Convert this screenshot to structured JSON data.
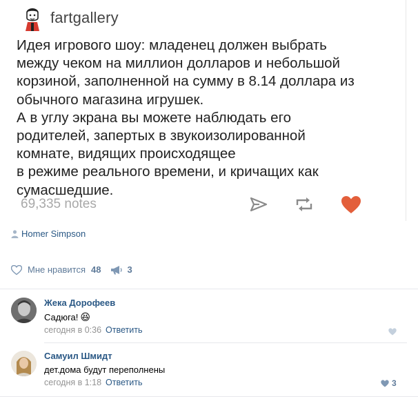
{
  "tumblr": {
    "username": "fartgallery",
    "text_lines": [
      "Идея игрового шоу: младенец должен выбрать",
      "между чеком на миллион долларов и небольшой",
      "корзиной, заполненной на сумму в 8.14 доллара из",
      "обычного магазина игрушек.",
      "А в углу экрана вы можете наблюдать его",
      "родителей, запертых в звукоизолированной",
      "комнате, видящих происходящее",
      "в режиме реального времени, и кричащих как",
      "сумасшедшие."
    ],
    "notes": "69,335 notes",
    "icons": [
      "share-icon",
      "reblog-icon",
      "heart-icon"
    ],
    "heart_color": "#e35f3b"
  },
  "post": {
    "author": "Homer Simpson",
    "author_icon": "person-icon",
    "like_label": "Мне нравится",
    "like_count": "48",
    "share_count": "3",
    "accent": "#2a5885",
    "muted": "#5e7a99"
  },
  "comments": [
    {
      "name": "Жека Дорофеев",
      "text": "Садюга!",
      "emoji": "😆",
      "time": "сегодня в 0:36",
      "reply": "Ответить",
      "likes": ""
    },
    {
      "name": "Самуил Шмидт",
      "text": "дет.дома будут переполнены",
      "time": "сегодня в 1:18",
      "reply": "Ответить",
      "likes": "3"
    }
  ]
}
